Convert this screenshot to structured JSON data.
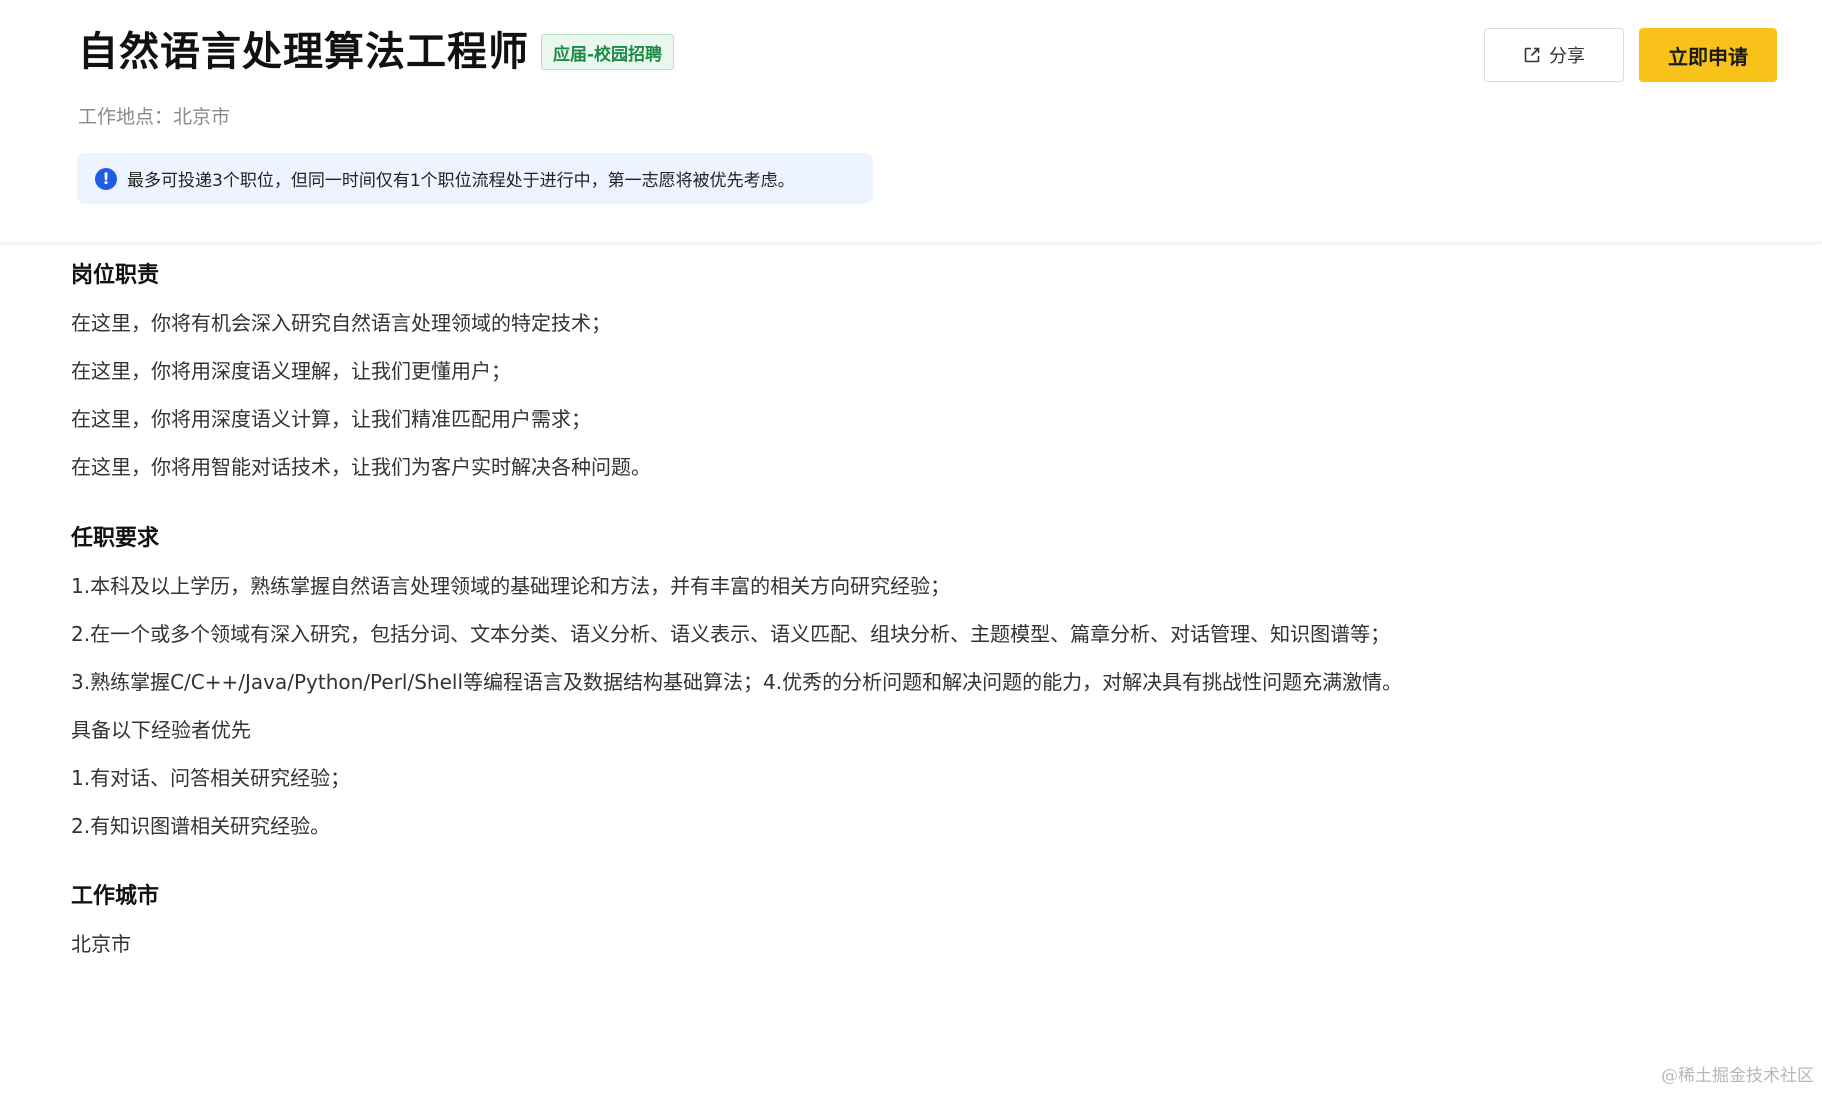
{
  "header": {
    "title": "自然语言处理算法工程师",
    "tag": "应届-校园招聘",
    "location": "工作地点：北京市",
    "notice": "最多可投递3个职位，但同一时间仅有1个职位流程处于进行中，第一志愿将被优先考虑。",
    "notice_icon": "!",
    "share_label": "分享",
    "apply_label": "立即申请"
  },
  "sections": [
    {
      "title": "岗位职责",
      "paragraphs": [
        "在这里，你将有机会深入研究自然语言处理领域的特定技术；",
        "在这里，你将用深度语义理解，让我们更懂用户；",
        "在这里，你将用深度语义计算，让我们精准匹配用户需求；",
        "在这里，你将用智能对话技术，让我们为客户实时解决各种问题。"
      ]
    },
    {
      "title": "任职要求",
      "paragraphs": [
        "1.本科及以上学历，熟练掌握自然语言处理领域的基础理论和方法，并有丰富的相关方向研究经验；",
        "2.在一个或多个领域有深入研究，包括分词、文本分类、语义分析、语义表示、语义匹配、组块分析、主题模型、篇章分析、对话管理、知识图谱等；",
        "3.熟练掌握C/C++/Java/Python/Perl/Shell等编程语言及数据结构基础算法；4.优秀的分析问题和解决问题的能力，对解决具有挑战性问题充满激情。",
        "具备以下经验者优先",
        "1.有对话、问答相关研究经验；",
        "2.有知识图谱相关研究经验。"
      ]
    },
    {
      "title": "工作城市",
      "paragraphs": [
        "北京市"
      ]
    }
  ],
  "watermark": "@稀土掘金技术社区",
  "colors": {
    "apply_button": "#f8c21b",
    "tag_text": "#1f8c46",
    "notice_bg": "#eef4ff",
    "notice_icon": "#1f5de5"
  },
  "icons": {
    "share": "share-external-icon",
    "notice": "info-exclamation-icon"
  }
}
